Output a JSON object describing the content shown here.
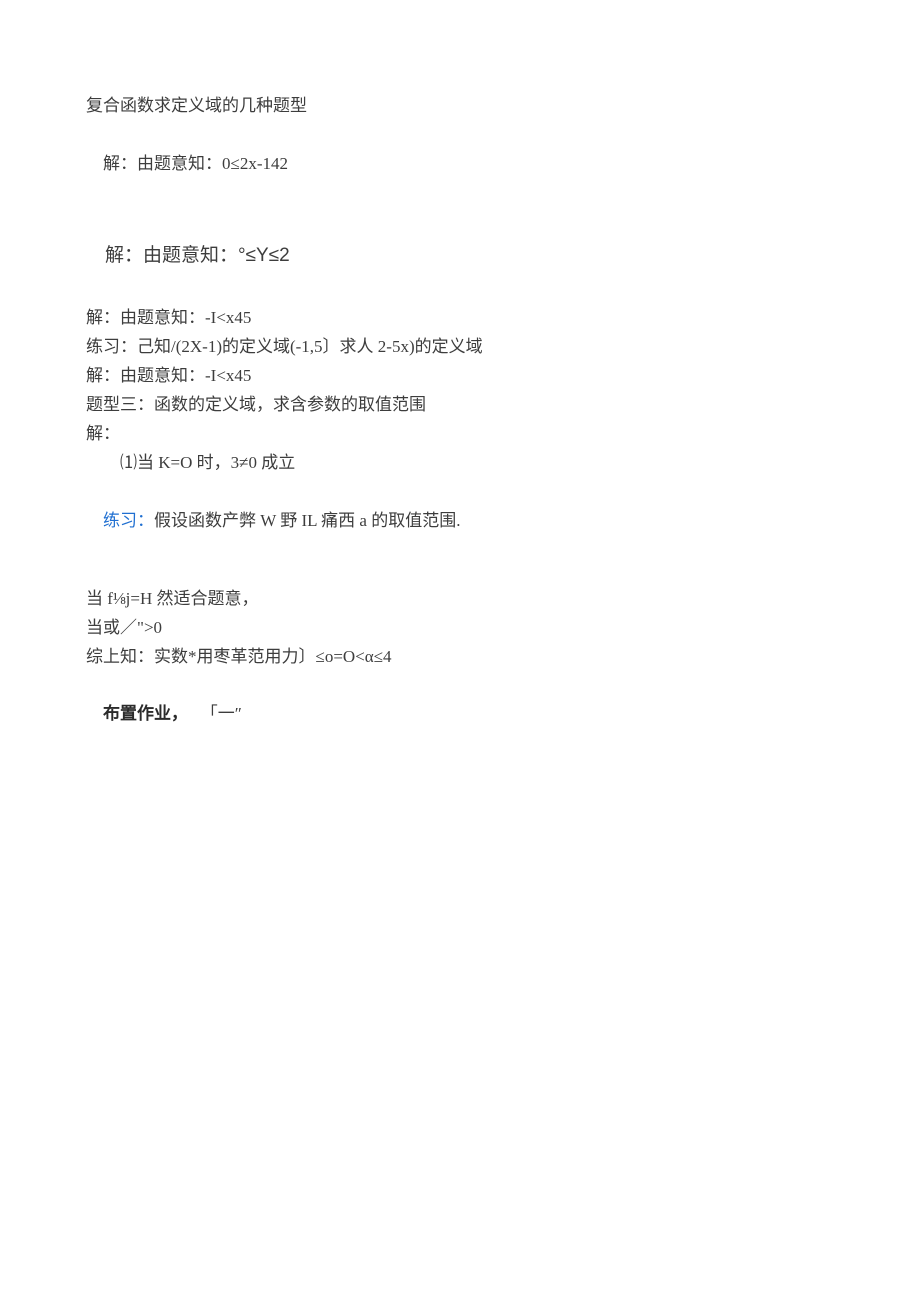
{
  "title": "复合函数求定义域的几种题型",
  "lines": {
    "l1": "解：由题意知：0≤2x-142",
    "l2_a": "解：由题意知：",
    "l2_b": "°≤Y≤2",
    "l3": "解：由题意知：-I<x45",
    "l4": "练习：己知/(2X-1)的定义域(-1,5〕求人 2-5x)的定义域",
    "l5": "解：由题意知：-I<x45",
    "l6": "题型三：函数的定义域，求含参数的取值范围",
    "l7": "解：",
    "l8": "⑴当 K=O 时，3≠0 成立",
    "l9_a": "练习：",
    "l9_b": "假设函数产弊 W 野 IL 痛西 a 的取值范围.",
    "l10": "当 f⅛j=H 然适合题意，",
    "l11": "当或／\">0",
    "l12": "综上知：实数*用枣革范用力〕≤o=O<α≤4",
    "l13_a": "布置作业，",
    "l13_b": "   「一″"
  }
}
